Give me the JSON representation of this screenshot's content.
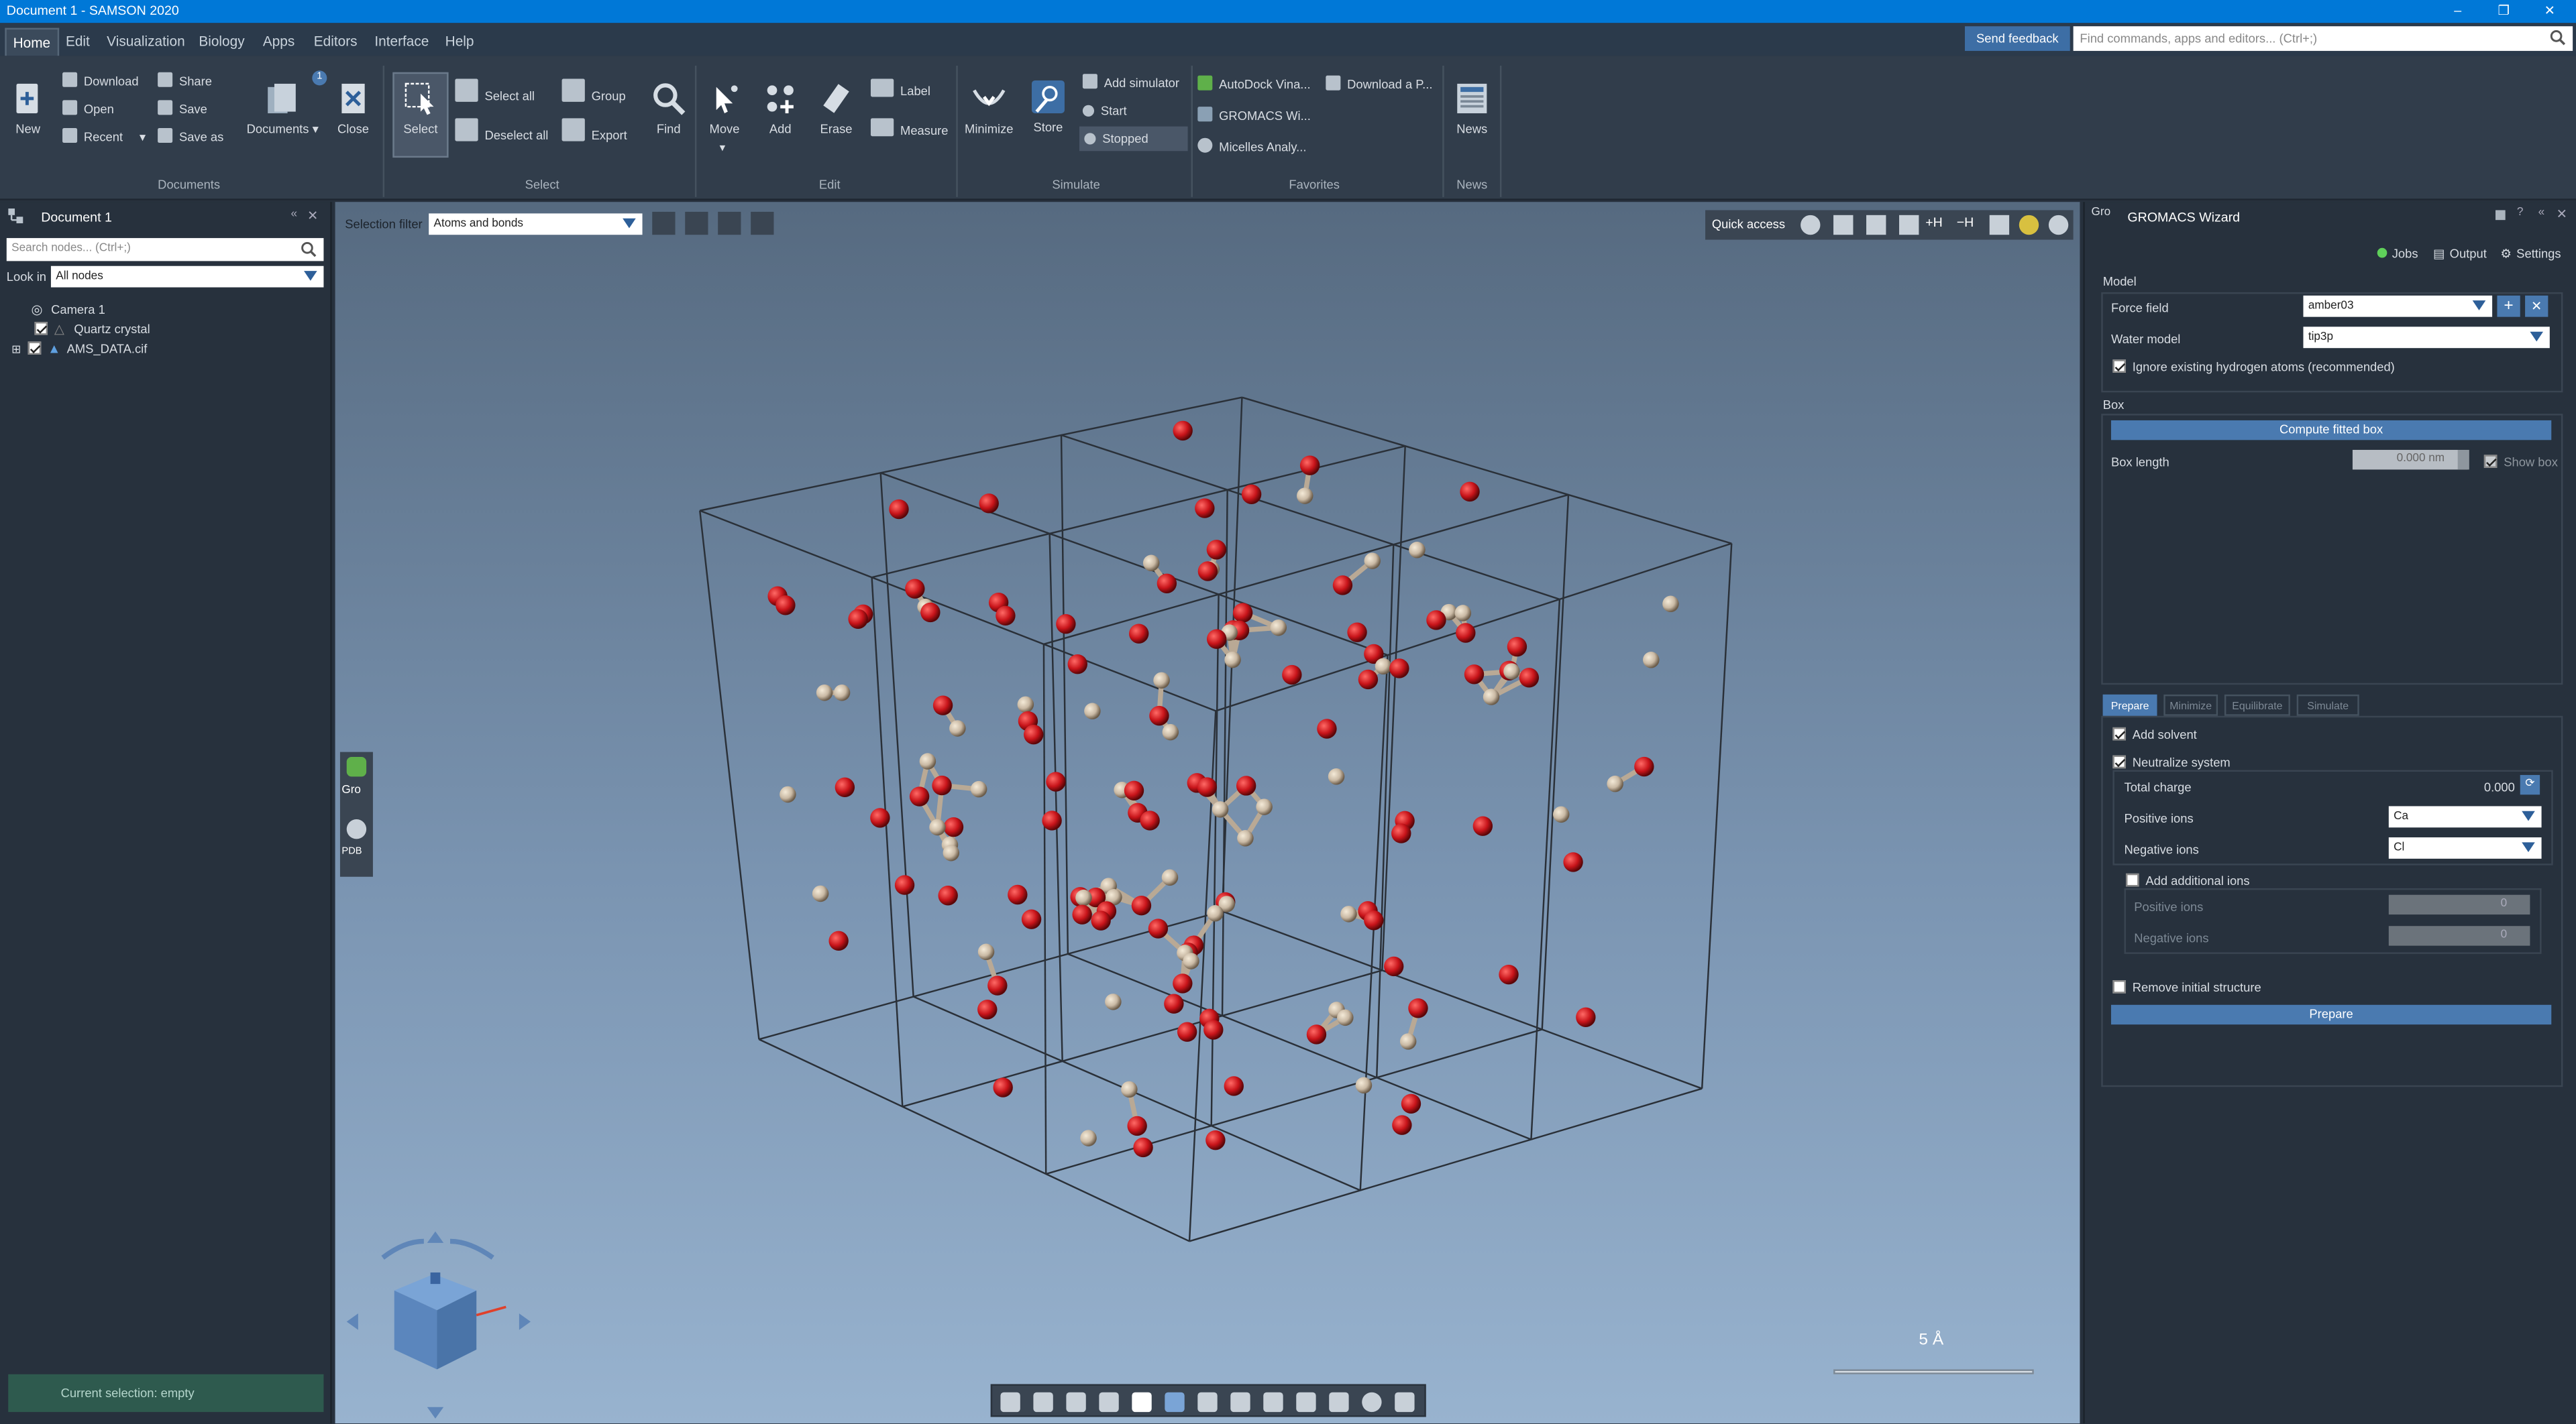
{
  "window": {
    "title": "Document 1 - SAMSON 2020",
    "minimize": "–",
    "restore": "❐",
    "close": "✕"
  },
  "menu": [
    "Home",
    "Edit",
    "Visualization",
    "Biology",
    "Apps",
    "Editors",
    "Interface",
    "Help"
  ],
  "header": {
    "send_feedback": "Send feedback",
    "search_placeholder": "Find commands, apps and editors... (Ctrl+;)"
  },
  "ribbon": {
    "documents": {
      "new": "New",
      "download": "Download",
      "open": "Open",
      "recent": "Recent",
      "share": "Share",
      "save": "Save",
      "save_as": "Save as",
      "documents": "Documents",
      "documents_badge": "1",
      "close": "Close",
      "group": "Documents"
    },
    "select": {
      "select": "Select",
      "select_all": "Select all",
      "deselect_all": "Deselect all",
      "group_btn": "Group",
      "export": "Export",
      "find": "Find",
      "group": "Select"
    },
    "edit": {
      "move": "Move",
      "add": "Add",
      "erase": "Erase",
      "label": "Label",
      "measure": "Measure",
      "group": "Edit"
    },
    "simulate": {
      "minimize": "Minimize",
      "store": "Store",
      "add_simulator": "Add simulator",
      "start": "Start",
      "stopped": "Stopped",
      "group": "Simulate"
    },
    "favorites": {
      "autodock": "AutoDock Vina...",
      "gromacs": "GROMACS Wi...",
      "micelles": "Micelles Analy...",
      "download_pdb": "Download a P...",
      "group": "Favorites"
    },
    "news": {
      "news": "News",
      "group": "News"
    }
  },
  "document_panel": {
    "title": "Document 1",
    "search_placeholder": "Search nodes... (Ctrl+;)",
    "look_in_label": "Look in",
    "look_in_value": "All nodes",
    "nodes": [
      {
        "label": "Camera 1",
        "checked": null
      },
      {
        "label": "Quartz crystal",
        "checked": true
      },
      {
        "label": "AMS_DATA.cif",
        "checked": true
      }
    ],
    "status": "Current selection: empty"
  },
  "viewport": {
    "selection_filter_label": "Selection filter",
    "selection_filter_value": "Atoms and bonds",
    "quick_access": "Quick access",
    "quick_access_plus_h": "+H",
    "quick_access_minus_h": "−H",
    "side_gro": "Gro",
    "side_pdb": "PDB",
    "scale_label": "5 Å",
    "colors": {
      "oxygen": "#c8141a",
      "silicon": "#c9b9a4",
      "cell": "#2a3038"
    }
  },
  "gromacs_wizard": {
    "title": "GROMACS Wizard",
    "header_tag": "Gro",
    "jobs": "Jobs",
    "output": "Output",
    "settings": "Settings",
    "model_section": "Model",
    "force_field_label": "Force field",
    "force_field_value": "amber03",
    "water_model_label": "Water model",
    "water_model_value": "tip3p",
    "ignore_h": "Ignore existing hydrogen atoms (recommended)",
    "box_section": "Box",
    "compute_box": "Compute fitted box",
    "box_length_label": "Box length",
    "box_length_value": "0.000 nm",
    "show_box": "Show box",
    "tabs": [
      "Prepare",
      "Minimize",
      "Equilibrate",
      "Simulate"
    ],
    "add_solvent": "Add solvent",
    "neutralize": "Neutralize system",
    "total_charge_label": "Total charge",
    "total_charge_value": "0.000",
    "positive_ions_label": "Positive ions",
    "positive_ions_value": "Ca",
    "negative_ions_label": "Negative ions",
    "negative_ions_value": "Cl",
    "add_additional_ions": "Add additional ions",
    "pos_ions_count_label": "Positive ions",
    "pos_ions_count": "0",
    "neg_ions_count_label": "Negative ions",
    "neg_ions_count": "0",
    "remove_initial": "Remove initial structure",
    "prepare_button": "Prepare"
  }
}
